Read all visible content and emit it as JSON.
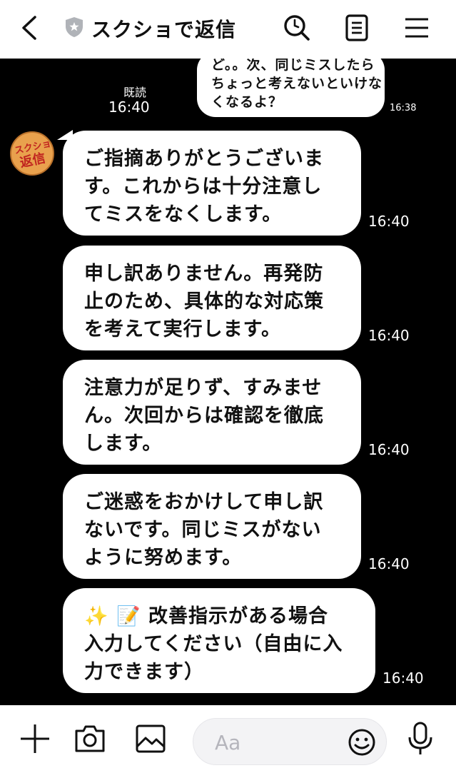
{
  "header": {
    "title": "スクショで返信"
  },
  "messages_sent": {
    "lines": [
      "ど。。次、同じミスしたら",
      "ちょっと考えないといけな",
      "くなるよ？"
    ],
    "time": "16:38",
    "read_status": "既読",
    "read_time": "16:40"
  },
  "avatar": {
    "text_top": "スクショ",
    "text_bottom": "返信"
  },
  "messages": [
    {
      "lines": [
        "ご指摘ありがとうございま",
        "す。これからは十分注意し",
        "てミスをなくします。"
      ],
      "time": "16:40"
    },
    {
      "lines": [
        "申し訳ありません。再発防",
        "止のため、具体的な対応策",
        "を考えて実行します。"
      ],
      "time": "16:40"
    },
    {
      "lines": [
        "注意力が足りず、すみませ",
        "ん。次回からは確認を徹底",
        "します。"
      ],
      "time": "16:40"
    },
    {
      "lines": [
        "ご迷惑をおかけして申し訳",
        "ないです。同じミスがない",
        "ように努めます。"
      ],
      "time": "16:40"
    },
    {
      "lines": [
        "✨ 📝 改善指示がある場合",
        "入力してください（自由に入",
        "力できます）"
      ],
      "time": "16:40"
    }
  ],
  "footer": {
    "input_placeholder": "Aa"
  }
}
